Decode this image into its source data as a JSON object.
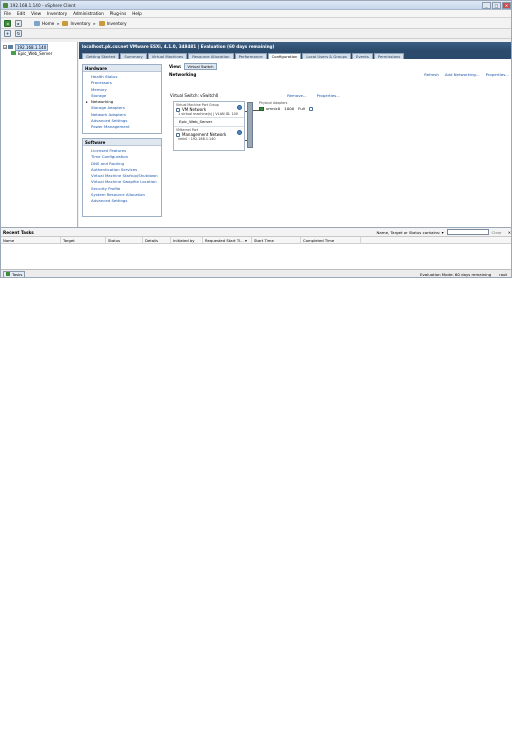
{
  "window": {
    "title": "192.168.1.140 - vSphere Client",
    "minimize": "_",
    "maximize": "□",
    "close": "✕"
  },
  "menu": [
    "File",
    "Edit",
    "View",
    "Inventory",
    "Administration",
    "Plug-ins",
    "Help"
  ],
  "breadcrumb": {
    "home": "Home",
    "inventory1": "Inventory",
    "inventory2": "Inventory"
  },
  "tree": {
    "host": "192.168.1.140",
    "vm": "Epic_Web_Server"
  },
  "host_header": "localhost.pk.csr.net VMware ESXi, 4.1.0, 348481 | Evaluation (60 days remaining)",
  "tabs": [
    "Getting Started",
    "Summary",
    "Virtual Machines",
    "Resource Allocation",
    "Performance",
    "Configuration",
    "Local Users & Groups",
    "Events",
    "Permissions"
  ],
  "active_tab": "Configuration",
  "hardware": {
    "title": "Hardware",
    "items": [
      "Health Status",
      "Processors",
      "Memory",
      "Storage",
      "Networking",
      "Storage Adapters",
      "Network Adapters",
      "Advanced Settings",
      "Power Management"
    ]
  },
  "software": {
    "title": "Software",
    "items": [
      "Licensed Features",
      "Time Configuration",
      "DNS and Routing",
      "Authentication Services",
      "Virtual Machine Startup/Shutdown",
      "Virtual Machine Swapfile Location",
      "Security Profile",
      "System Resource Allocation",
      "Advanced Settings"
    ]
  },
  "networking": {
    "view_label": "View:",
    "view_value": "Virtual Switch",
    "title": "Networking",
    "actions": [
      "Refresh",
      "Add Networking...",
      "Properties..."
    ],
    "vswitch_title": "Virtual Switch: vSwitch0",
    "vswitch_actions": [
      "Remove...",
      "Properties..."
    ],
    "vm_pg_sub": "Virtual Machine Port Group",
    "vm_pg_name": "VM Network",
    "vm_pg_detail": "1 virtual machine(s) | VLAN ID: 100",
    "vm_name": "Epic_Web_Server",
    "vmk_sub": "VMkernel Port",
    "vmk_name": "Management Network",
    "vmk_detail": "vmk0 : 192.168.1.140",
    "pa_sub": "Physical Adapters",
    "pa_nic": "vmnic0",
    "pa_speed": "1000",
    "pa_duplex": "Full"
  },
  "recent_tasks": {
    "title": "Recent Tasks",
    "filter_label": "Name, Target or Status contains: ▾",
    "clear": "Clear",
    "close": "✕",
    "columns": [
      "Name",
      "Target",
      "Status",
      "Details",
      "Initiated by",
      "Requested Start Ti... ▾",
      "Start Time",
      "Completed Time"
    ]
  },
  "status": {
    "tasks": "Tasks",
    "eval": "Evaluation Mode: 60 days remaining",
    "user": "root"
  }
}
